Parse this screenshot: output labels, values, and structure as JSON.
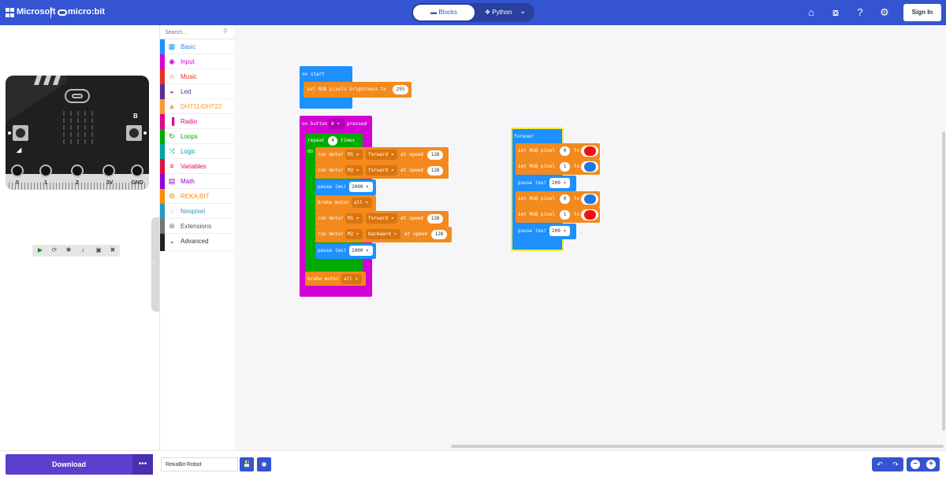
{
  "header": {
    "brand": "Microsoft",
    "product": "micro:bit",
    "mode_blocks": "Blocks",
    "mode_python": "Python",
    "signin": "Sign In",
    "icons": [
      "home-icon",
      "share-icon",
      "help-icon",
      "settings-icon"
    ]
  },
  "simulator": {
    "pins": [
      "0",
      "1",
      "2",
      "3V",
      "GND"
    ],
    "button_a": "A",
    "button_b": "B",
    "controls": [
      "play-icon",
      "restart-icon",
      "slowmo-icon",
      "mute-icon",
      "screenshot-icon",
      "fullscreen-icon"
    ]
  },
  "toolbox": {
    "search_placeholder": "Search...",
    "categories": [
      {
        "label": "Basic",
        "color": "#1e90ff",
        "icon": "grid-icon"
      },
      {
        "label": "Input",
        "color": "#d400d4",
        "icon": "input-icon"
      },
      {
        "label": "Music",
        "color": "#e63022",
        "icon": "headphones-icon"
      },
      {
        "label": "Led",
        "color": "#5c2d91",
        "icon": "toggle-icon"
      },
      {
        "label": "DHT11/DHT22",
        "color": "#f29b3b",
        "icon": "drop-icon"
      },
      {
        "label": "Radio",
        "color": "#e3008c",
        "icon": "signal-icon"
      },
      {
        "label": "Loops",
        "color": "#00aa00",
        "icon": "loop-icon"
      },
      {
        "label": "Logic",
        "color": "#00a4a6",
        "icon": "shuffle-icon"
      },
      {
        "label": "Variables",
        "color": "#dc143c",
        "icon": "lines-icon"
      },
      {
        "label": "Math",
        "color": "#9400d3",
        "icon": "calculator-icon"
      },
      {
        "label": "REKA:BIT",
        "color": "#ff8c00",
        "icon": "gears-icon"
      },
      {
        "label": "Neopixel",
        "color": "#2699bf",
        "icon": "ring-icon"
      },
      {
        "label": "Extensions",
        "color": "#757575",
        "icon": "plus-icon"
      }
    ],
    "advanced": "Advanced"
  },
  "blocks": {
    "on_start": {
      "label": "on start",
      "set_brightness": "set RGB pixels brightness to",
      "brightness": "255"
    },
    "on_button": {
      "label_on": "on button",
      "button": "A",
      "label_pressed": "pressed",
      "repeat": "repeat",
      "times_value": "4",
      "times": "times",
      "do": "do",
      "run_motor": "run motor",
      "at_speed": "at speed",
      "pause": "pause (ms)",
      "brake_motor": "brake motor",
      "motor_m1": "M1",
      "motor_m2": "M2",
      "forward": "forward",
      "backward": "backward",
      "speed": "128",
      "pause_1": "2000",
      "pause_2": "1000",
      "all": "all"
    },
    "forever": {
      "label": "forever",
      "set_pixel": "set RGB pixel",
      "to": "to",
      "pixel_0": "0",
      "pixel_1": "1",
      "pause": "pause (ms)",
      "pause_value": "200",
      "red": "#ee1111",
      "blue": "#1e78e0"
    }
  },
  "footer": {
    "download": "Download",
    "more": "•••",
    "project_name": "RekaBit-Robot",
    "icons": [
      "save-icon",
      "github-icon",
      "undo-icon",
      "redo-icon",
      "zoom-out-icon",
      "zoom-in-icon"
    ]
  }
}
